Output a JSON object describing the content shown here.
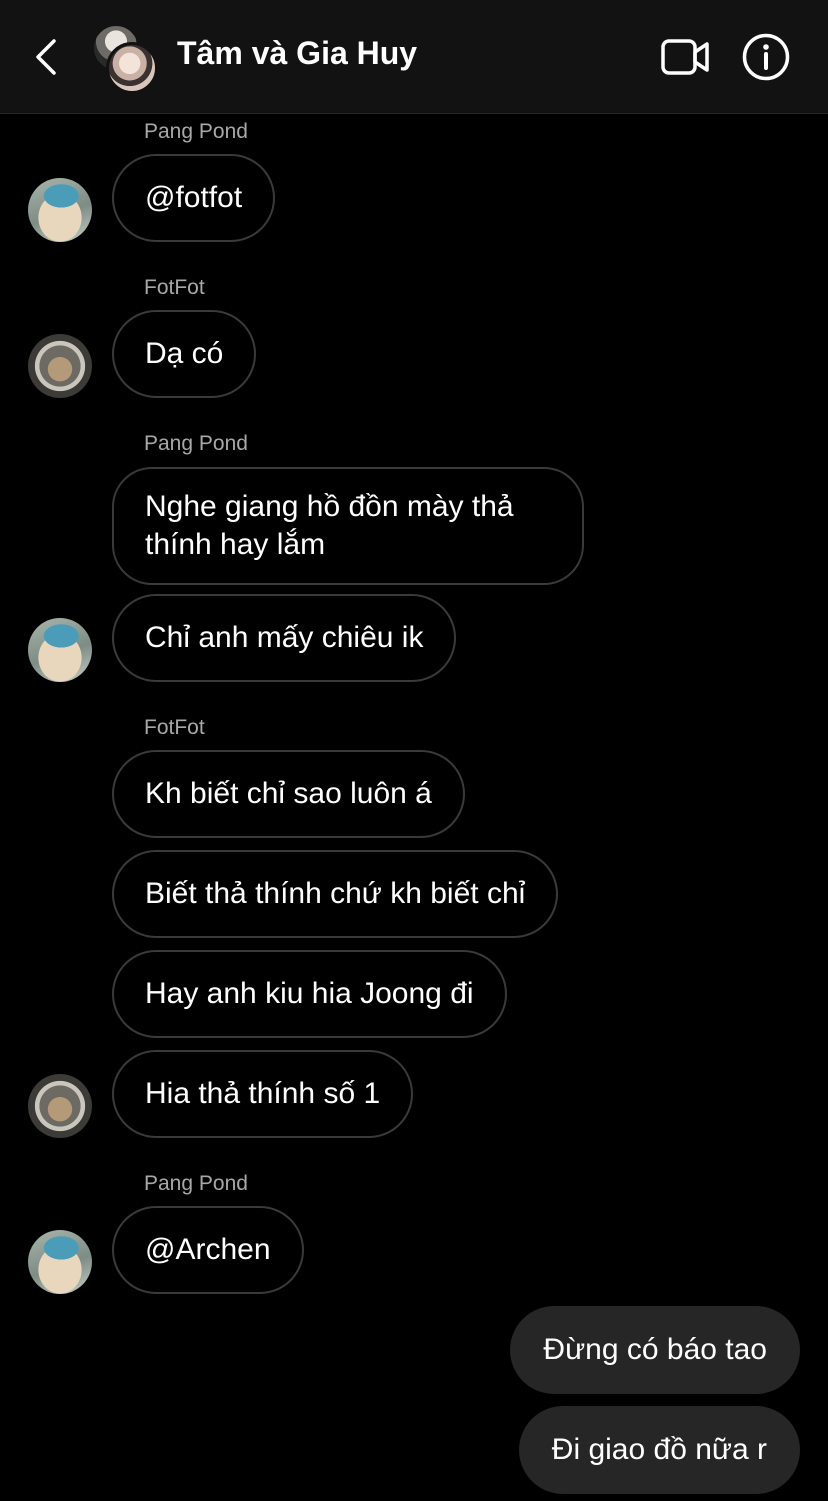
{
  "header": {
    "title": "Tâm và Gia Huy",
    "back_icon": "chevron-left-icon",
    "video_icon": "video-camera-icon",
    "info_icon": "info-icon"
  },
  "colors": {
    "background": "#000000",
    "header_bg": "#121212",
    "incoming_bubble_border": "#3a3a3a",
    "outgoing_bubble_bg": "#262626",
    "sender_name": "#a8a8a8"
  },
  "messages": [
    {
      "sender": "Pang Pond",
      "text": "@fotfot"
    },
    {
      "sender": "FotFot",
      "text": "Dạ có"
    },
    {
      "sender": "Pang Pond",
      "text": "Nghe giang hồ đồn mày thả thính hay lắm"
    },
    {
      "sender": "Pang Pond",
      "text": "Chỉ anh mấy chiêu ik"
    },
    {
      "sender": "FotFot",
      "text": "Kh biết chỉ sao luôn á"
    },
    {
      "sender": "FotFot",
      "text": "Biết thả thính chứ kh biết chỉ"
    },
    {
      "sender": "FotFot",
      "text": "Hay anh kiu hia Joong đi"
    },
    {
      "sender": "FotFot",
      "text": "Hia thả thính số 1"
    },
    {
      "sender": "Pang Pond",
      "text": "@Archen"
    },
    {
      "sender": "me",
      "text": "Đừng có báo tao"
    },
    {
      "sender": "me",
      "text": "Đi giao đồ nữa r"
    }
  ]
}
